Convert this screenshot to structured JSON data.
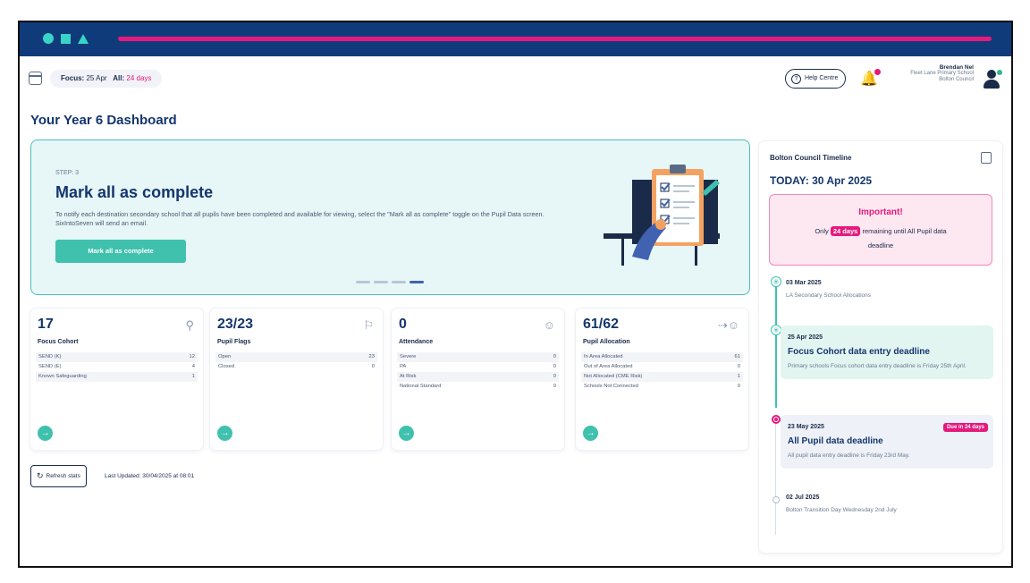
{
  "header": {
    "focus_label": "Focus:",
    "focus_value": "25 Apr",
    "all_label": "All:",
    "all_value": "24 days",
    "help_label": "Help Centre",
    "user_name": "Brendan Nel",
    "user_school": "Fleet Lane Primary School",
    "user_council": "Bolton Council"
  },
  "page": {
    "title": "Your Year 6 Dashboard"
  },
  "hero": {
    "step": "STEP: 3",
    "title": "Mark all as complete",
    "description": "To notify each destination secondary school that all pupils have been completed and available for viewing, select the \"Mark all as complete\" toggle on the Pupil Data screen. SixIntoSeven will send an email.",
    "cta": "Mark all as complete"
  },
  "stats": [
    {
      "value": "17",
      "label": "Focus Cohort",
      "icon": "search-icon",
      "rows": [
        {
          "k": "SEND (K)",
          "v": "12"
        },
        {
          "k": "SEND (E)",
          "v": "4"
        },
        {
          "k": "Known Safeguarding",
          "v": "1"
        }
      ]
    },
    {
      "value": "23/23",
      "label": "Pupil Flags",
      "icon": "flag-icon",
      "rows": [
        {
          "k": "Open",
          "v": "23"
        },
        {
          "k": "Closed",
          "v": "0"
        }
      ]
    },
    {
      "value": "0",
      "label": "Attendance",
      "icon": "users-icon",
      "rows": [
        {
          "k": "Severe",
          "v": "0"
        },
        {
          "k": "PA",
          "v": "0"
        },
        {
          "k": "At Risk",
          "v": "0"
        },
        {
          "k": "National Standard",
          "v": "0"
        }
      ]
    },
    {
      "value": "61/62",
      "label": "Pupil Allocation",
      "icon": "user-arrow-icon",
      "rows": [
        {
          "k": "In Area Allocated",
          "v": "61"
        },
        {
          "k": "Out of Area Allocated",
          "v": "0"
        },
        {
          "k": "Not Allocated (CME Risk)",
          "v": "1"
        },
        {
          "k": "Schools Not Connected",
          "v": "0"
        }
      ]
    }
  ],
  "refresh": {
    "label": "Refresh stats",
    "updated": "Last Updated: 30/04/2025 at 08:01"
  },
  "timeline": {
    "title": "Bolton Council Timeline",
    "today": "TODAY: 30 Apr 2025",
    "important_heading": "Important!",
    "important_pre": "Only",
    "important_days": "24 days",
    "important_post": "remaining until All Pupil data deadline",
    "events": [
      {
        "date": "03 Mar 2025",
        "title": "",
        "sub": "LA Secondary School Allocations"
      },
      {
        "date": "25 Apr 2025",
        "title": "Focus Cohort data entry deadline",
        "sub": "Primary schools Focus cohort data entry deadline is Friday 25th April."
      },
      {
        "date": "23 May 2025",
        "title": "All Pupil data deadline",
        "sub": "All pupil data entry deadline is Friday 23rd May.",
        "badge": "Due in 24 days"
      },
      {
        "date": "02 Jul 2025",
        "title": "",
        "sub": "Bolton Transition Day Wednesday 2nd July"
      }
    ]
  },
  "colors": {
    "brand_navy": "#0f3b7a",
    "accent_pink": "#e6197c",
    "accent_teal": "#3fc1ae"
  }
}
